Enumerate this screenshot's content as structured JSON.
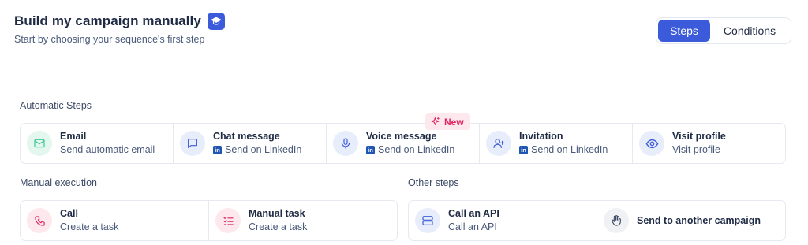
{
  "header": {
    "title": "Build my campaign manually",
    "subtitle": "Start by choosing your sequence's first step"
  },
  "toggle": {
    "steps": "Steps",
    "conditions": "Conditions",
    "active": "Steps"
  },
  "sections": {
    "automatic": {
      "label": "Automatic Steps",
      "badge": "New",
      "items": [
        {
          "title": "Email",
          "subtitle": "Send automatic email",
          "icon": "mail-icon",
          "linkedin": false
        },
        {
          "title": "Chat message",
          "subtitle": "Send on LinkedIn",
          "icon": "chat-icon",
          "linkedin": true
        },
        {
          "title": "Voice message",
          "subtitle": "Send on LinkedIn",
          "icon": "microphone-icon",
          "linkedin": true
        },
        {
          "title": "Invitation",
          "subtitle": "Send on LinkedIn",
          "icon": "user-plus-icon",
          "linkedin": true
        },
        {
          "title": "Visit profile",
          "subtitle": "Visit profile",
          "icon": "eye-icon",
          "linkedin": false
        }
      ]
    },
    "manual": {
      "label": "Manual execution",
      "items": [
        {
          "title": "Call",
          "subtitle": "Create a task",
          "icon": "phone-icon"
        },
        {
          "title": "Manual task",
          "subtitle": "Create a task",
          "icon": "checklist-icon"
        }
      ]
    },
    "other": {
      "label": "Other steps",
      "items": [
        {
          "title": "Call an API",
          "subtitle": "Call an API",
          "icon": "server-icon"
        },
        {
          "title": "Send to another campaign",
          "icon": "hand-icon"
        }
      ]
    }
  },
  "linkedin_badge": "in",
  "colors": {
    "accent": "#3b5bdb",
    "new_badge_text": "#e0245e",
    "new_badge_bg": "#fde8ee",
    "email_icon_bg": "#e3f7ef",
    "email_icon": "#3cc79a",
    "blue_icon_bg": "#e7edfb",
    "blue_icon": "#3b5bdb",
    "pink_icon_bg": "#fde8ee",
    "pink_icon": "#e0245e",
    "grey_icon_bg": "#f0f1f4",
    "grey_icon": "#3c4a66"
  }
}
